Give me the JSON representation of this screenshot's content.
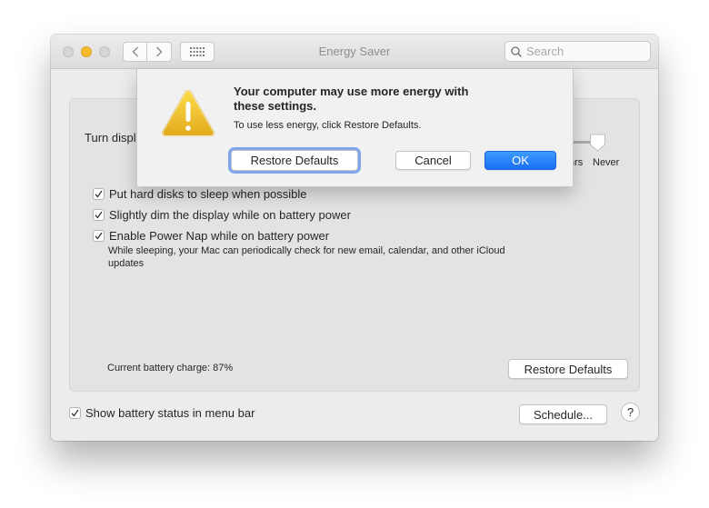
{
  "window": {
    "title": "Energy Saver",
    "search_placeholder": "Search",
    "search_value": ""
  },
  "toolbar": {
    "back_icon": "chevron-left-icon",
    "forward_icon": "chevron-right-icon",
    "show_all_icon": "grid-icon"
  },
  "panel": {
    "turn_display_label": "Turn displ",
    "slider": {
      "tick_labels": [
        "hrs",
        "Never"
      ],
      "selected": "Never"
    },
    "checkboxes": [
      {
        "label": "Put hard disks to sleep when possible",
        "checked": true
      },
      {
        "label": "Slightly dim the display while on battery power",
        "checked": true
      },
      {
        "label": "Enable Power Nap while on battery power",
        "checked": true
      }
    ],
    "power_nap_description": "While sleeping, your Mac can periodically check for new email, calendar, and other iCloud updates",
    "battery_charge": "Current battery charge: 87%",
    "restore_defaults_label": "Restore Defaults"
  },
  "footer": {
    "show_battery_label": "Show battery status in menu bar",
    "show_battery_checked": true,
    "schedule_label": "Schedule...",
    "help_label": "?"
  },
  "alert": {
    "icon": "warning-icon",
    "title": "Your computer may use more energy with these settings.",
    "message": "To use less energy, click Restore Defaults.",
    "restore_label": "Restore Defaults",
    "cancel_label": "Cancel",
    "ok_label": "OK"
  },
  "colors": {
    "accent": "#1a6ef5",
    "focus_ring": "#7ea6ef",
    "warning": "#f0c02a",
    "minimize": "#f5bd2e"
  }
}
